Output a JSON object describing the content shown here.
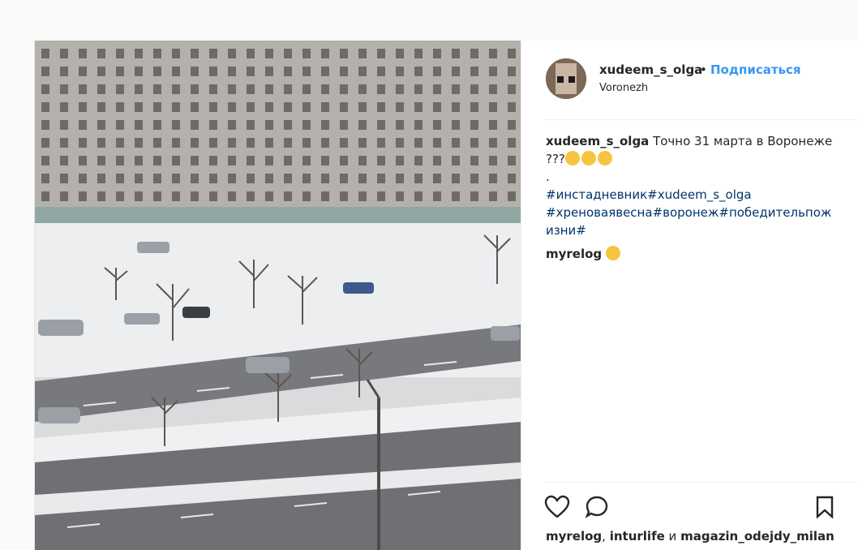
{
  "post": {
    "username": "xudeem_s_olga",
    "dot": "•",
    "follow_label": "Подписаться",
    "location": "Voronezh",
    "caption": {
      "username": "xudeem_s_olga",
      "text_line1": "Точно 31 марта в Воронеже",
      "text_line2": "???",
      "dot_line": ".",
      "tags_line1": "#инстадневник#xudeem_s_olga",
      "tags_line2": "#хреноваявесна#воронеж#победительпож",
      "tags_line3": "изни#"
    },
    "comments": [
      {
        "username": "myrelog"
      }
    ],
    "likes": {
      "user1": "myrelog",
      "sep": ", ",
      "user2": "inturlife",
      "and": " и ",
      "user3": "magazin_odejdy_milan"
    }
  },
  "icons": {
    "like": "heart-icon",
    "comment": "comment-bubble-icon",
    "save": "bookmark-icon"
  },
  "colors": {
    "link": "#3897f0",
    "hashtag": "#003569",
    "text": "#262626"
  }
}
